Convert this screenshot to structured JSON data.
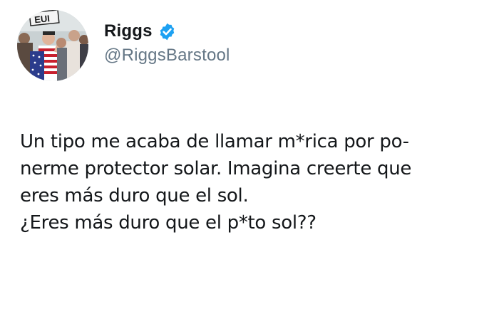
{
  "author": {
    "display_name": "Riggs",
    "handle": "@RiggsBarstool",
    "avatar_sign_text": "EUI",
    "verified_icon": "verified-badge-icon",
    "verified_color": "#1da1f2"
  },
  "tweet": {
    "lines": [
      "Un tipo me acaba de llamar m*rica por po-",
      "nerme protector solar. Imagina creerte que",
      "eres más duro que el sol.",
      "¿Eres más duro que el p*to sol??"
    ]
  },
  "colors": {
    "text": "#14171a",
    "secondary_text": "#657786",
    "background": "#ffffff"
  }
}
